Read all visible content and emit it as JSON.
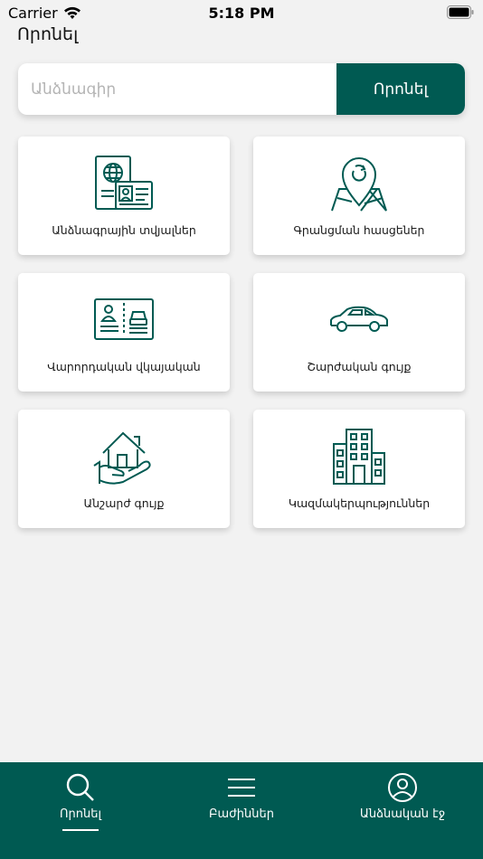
{
  "status_bar": {
    "carrier": "Carrier",
    "time": "5:18 PM"
  },
  "header": {
    "title": "Որոնել"
  },
  "search": {
    "placeholder": "Անձնագիր",
    "value": "",
    "button_label": "Որոնել"
  },
  "categories": [
    {
      "label": "Անձնագրային տվյալներ",
      "icon": "passport-icon"
    },
    {
      "label": "Գրանցման հասցեներ",
      "icon": "map-pin-icon"
    },
    {
      "label": "Վարորդական վկայական",
      "icon": "drivers-license-icon"
    },
    {
      "label": "Շարժական գույք",
      "icon": "car-icon"
    },
    {
      "label": "Անշարժ գույք",
      "icon": "house-in-hand-icon"
    },
    {
      "label": "Կազմակերպություններ",
      "icon": "office-building-icon"
    }
  ],
  "tab_bar": {
    "tabs": [
      {
        "label": "Որոնել",
        "icon": "search-icon",
        "active": true
      },
      {
        "label": "Բաժիններ",
        "icon": "menu-icon",
        "active": false
      },
      {
        "label": "Անձնական էջ",
        "icon": "profile-icon",
        "active": false
      }
    ]
  },
  "colors": {
    "primary": "#005a52",
    "background": "#f2f2f2",
    "card": "#ffffff"
  }
}
